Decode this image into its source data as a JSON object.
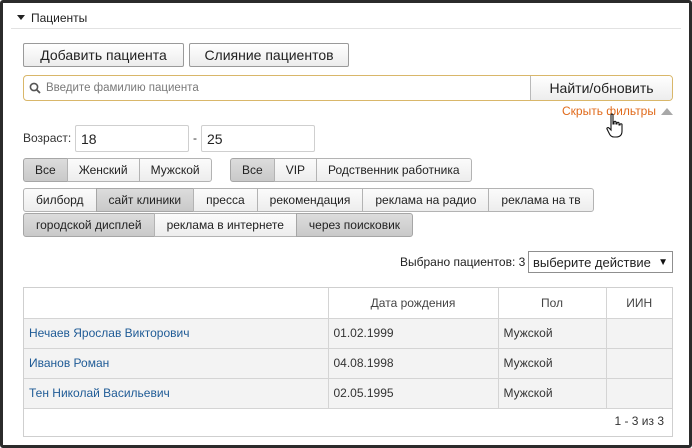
{
  "panel": {
    "title": "Пациенты"
  },
  "toolbar": {
    "add_label": "Добавить пациента",
    "merge_label": "Слияние пациентов"
  },
  "search": {
    "placeholder": "Введите фамилию пациента",
    "value": "",
    "button_label": "Найти/обновить"
  },
  "filters": {
    "hide_label": "Скрыть фильтры",
    "age_label": "Возраст:",
    "age_from": "18",
    "age_separator": "-",
    "age_to": "25",
    "gender": [
      {
        "label": "Все",
        "active": true
      },
      {
        "label": "Женский",
        "active": false
      },
      {
        "label": "Мужской",
        "active": false
      }
    ],
    "category": [
      {
        "label": "Все",
        "active": true
      },
      {
        "label": "VIP",
        "active": false
      },
      {
        "label": "Родственник работника",
        "active": false
      }
    ],
    "sources_row1": [
      {
        "label": "билборд",
        "active": false
      },
      {
        "label": "сайт клиники",
        "active": true
      },
      {
        "label": "пресса",
        "active": false
      },
      {
        "label": "рекомендация",
        "active": false
      },
      {
        "label": "реклама на радио",
        "active": false
      },
      {
        "label": "реклама на тв",
        "active": false
      }
    ],
    "sources_row2": [
      {
        "label": "городской дисплей",
        "active": true
      },
      {
        "label": "реклама в интернете",
        "active": false
      },
      {
        "label": "через поисковик",
        "active": true
      }
    ]
  },
  "selection": {
    "label": "Выбрано пациентов: 3",
    "action_value": "выберите действие"
  },
  "table": {
    "headers": [
      "",
      "Дата рождения",
      "Пол",
      "ИИН"
    ],
    "rows": [
      {
        "name": "Нечаев Ярослав Викторович",
        "birth": "01.02.1999",
        "gender": "Мужской",
        "iin": ""
      },
      {
        "name": "Иванов Роман",
        "birth": "04.08.1998",
        "gender": "Мужской",
        "iin": ""
      },
      {
        "name": "Тен Николай Васильевич",
        "birth": "02.05.1995",
        "gender": "Мужской",
        "iin": ""
      }
    ],
    "pager": "1 - 3 из 3"
  },
  "colors": {
    "link": "#1f5b96",
    "accent": "#e06a1b",
    "search_border": "#d9b76a"
  }
}
